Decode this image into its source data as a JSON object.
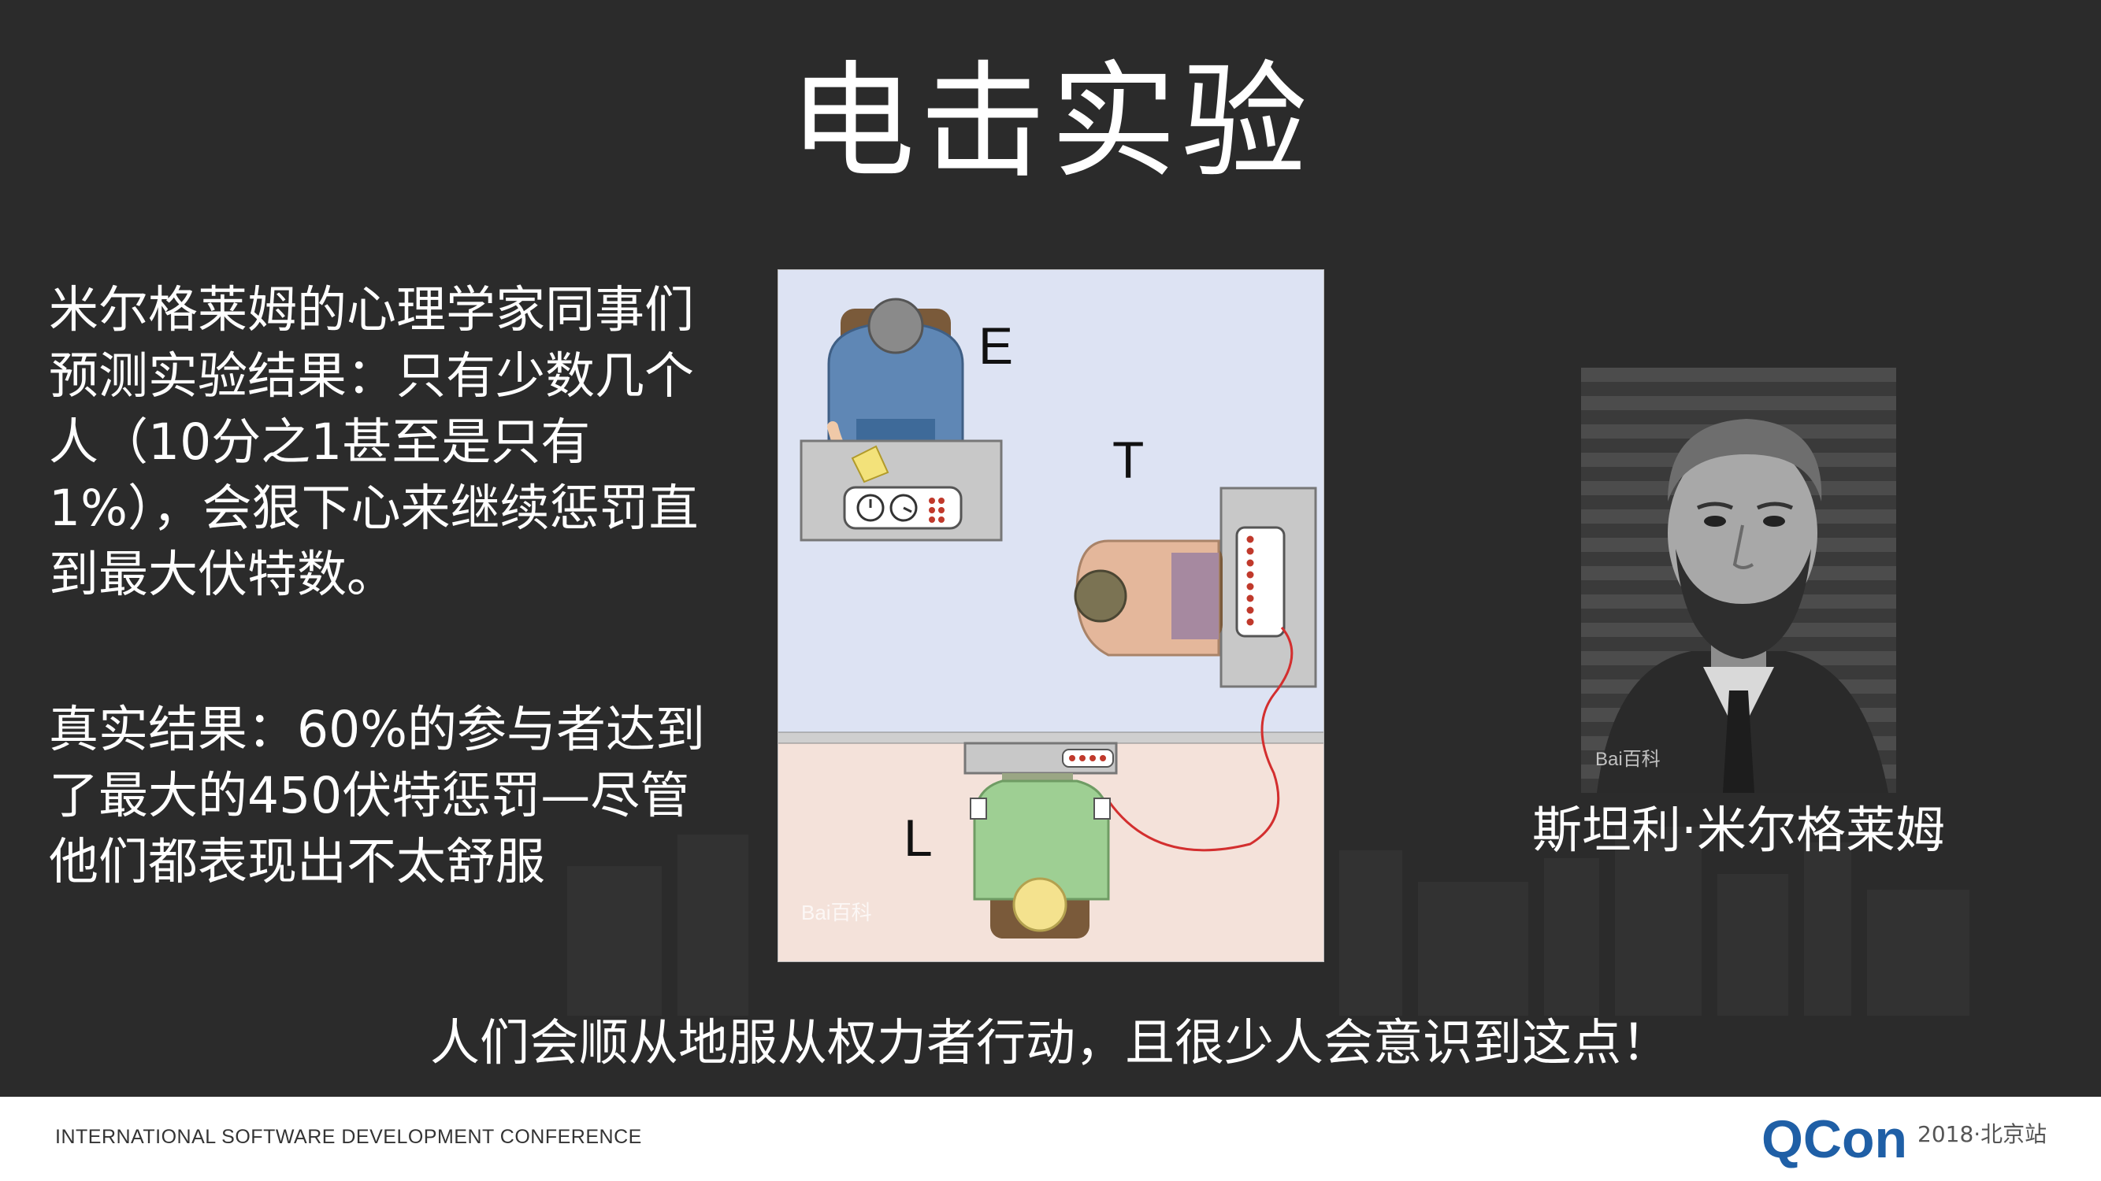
{
  "slide": {
    "title": "电击实验",
    "paragraph1": "米尔格莱姆的心理学家同事们预测实验结果：只有少数几个人（10分之1甚至是只有1%），会狠下心来继续惩罚直到最大伏特数。",
    "paragraph2": "真实结果：60%的参与者达到了最大的450伏特惩罚—尽管他们都表现出不太舒服",
    "bottom_line": "人们会顺从地服从权力者行动，且很少人会意识到这点！"
  },
  "diagram": {
    "label_e": "E",
    "label_t": "T",
    "label_l": "L",
    "watermark": "Bai百科"
  },
  "photo": {
    "caption": "斯坦利·米尔格莱姆",
    "watermark": "Bai百科"
  },
  "footer": {
    "conference": "INTERNATIONAL SOFTWARE DEVELOPMENT CONFERENCE",
    "brand": "QCon",
    "edition": "2018·北京站"
  },
  "colors": {
    "background": "#2b2b2b",
    "text": "#ffffff",
    "brand_green": "#1f8a4c",
    "brand_blue": "#1f5fa6"
  }
}
